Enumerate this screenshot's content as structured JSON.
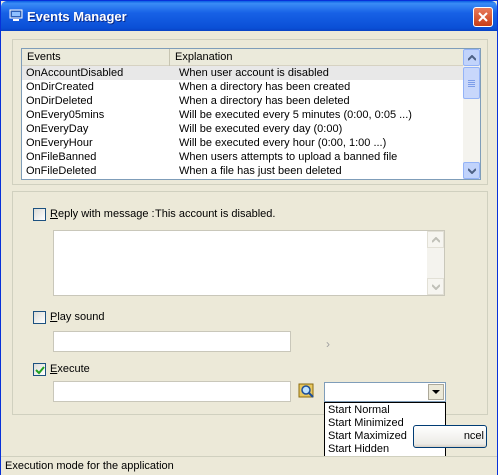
{
  "window": {
    "title": "Events Manager",
    "title_bar_color": "#0a4fd6"
  },
  "events_list": {
    "columns": [
      "Events",
      "Explanation"
    ],
    "rows": [
      {
        "event": "OnAccountDisabled",
        "explanation": "When user account is disabled",
        "selected": true
      },
      {
        "event": "OnDirCreated",
        "explanation": "When a directory has been created"
      },
      {
        "event": "OnDirDeleted",
        "explanation": "When a directory has been deleted"
      },
      {
        "event": "OnEvery05mins",
        "explanation": "Will be executed every 5 minutes (0:00, 0:05 ...)"
      },
      {
        "event": "OnEveryDay",
        "explanation": "Will be executed every day (0:00)"
      },
      {
        "event": "OnEveryHour",
        "explanation": "Will be executed every hour (0:00, 1:00 ...)"
      },
      {
        "event": "OnFileBanned",
        "explanation": "When users attempts to upload a banned file"
      },
      {
        "event": "OnFileDeleted",
        "explanation": "When a file has just been deleted"
      }
    ]
  },
  "reply": {
    "checked": false,
    "label_underlined": "R",
    "label_rest": "eply with message :",
    "message": "This account is disabled."
  },
  "sound": {
    "checked": false,
    "label_underlined": "P",
    "label_rest": "lay sound"
  },
  "execute": {
    "checked": true,
    "label_underlined": "E",
    "label_rest": "xecute",
    "mode_options": [
      "Start Normal",
      "Start Minimized",
      "Start Maximized",
      "Start Hidden"
    ]
  },
  "buttons": {
    "cancel_label": "Cancel",
    "cancel_visible": "ncel"
  },
  "status": {
    "text": "Execution mode for the application"
  }
}
